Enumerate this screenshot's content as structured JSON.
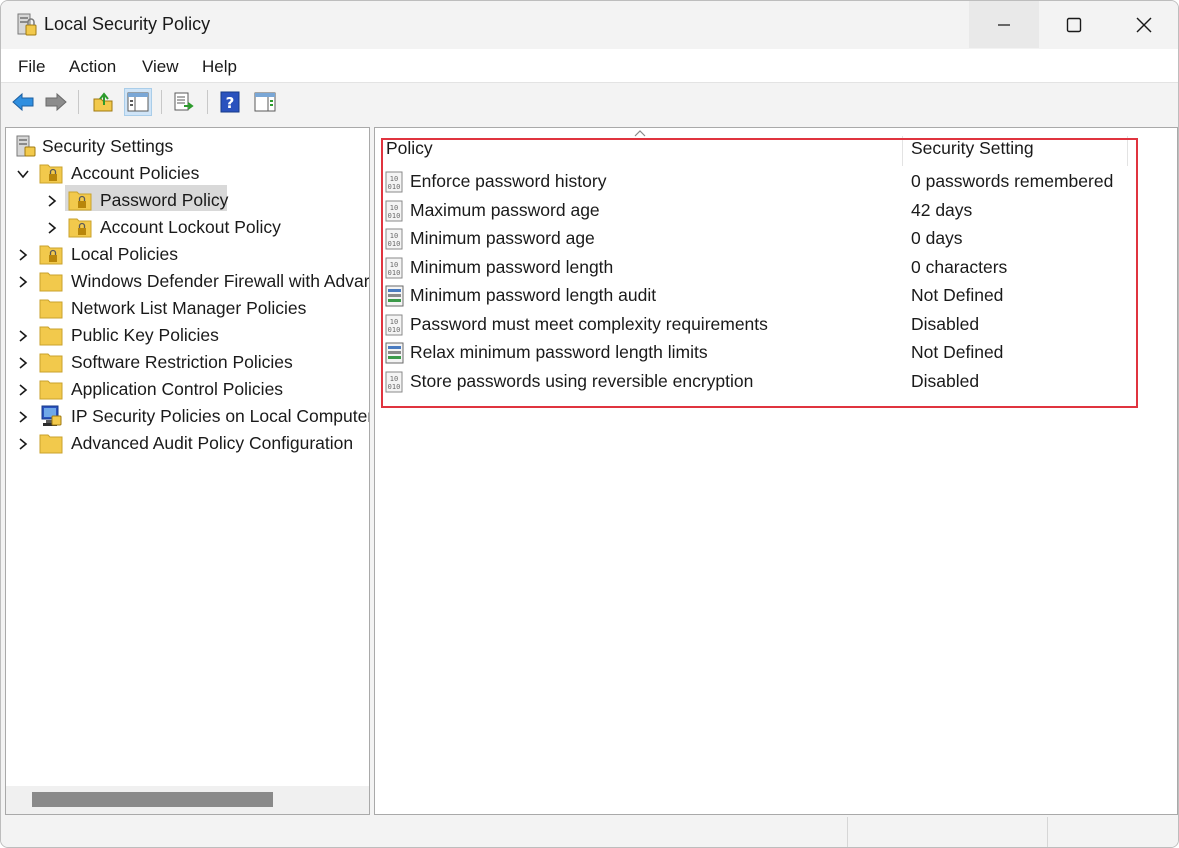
{
  "window": {
    "title": "Local Security Policy",
    "icon": "security-policy-icon"
  },
  "menu": [
    "File",
    "Action",
    "View",
    "Help"
  ],
  "toolbar": {
    "buttons": [
      "back-arrow-icon",
      "forward-arrow-icon",
      "up-folder-icon",
      "show-hide-tree-icon",
      "export-list-icon",
      "help-icon",
      "action-pane-icon"
    ]
  },
  "tree": {
    "root": "Security Settings",
    "items": [
      {
        "label": "Account Policies",
        "state": "expanded"
      },
      {
        "label": "Password Policy",
        "state": "selected"
      },
      {
        "label": "Account Lockout Policy",
        "state": "collapsed"
      },
      {
        "label": "Local Policies",
        "state": "collapsed"
      },
      {
        "label": "Windows Defender Firewall with Advar",
        "state": "collapsed"
      },
      {
        "label": "Network List Manager Policies",
        "state": "leaf"
      },
      {
        "label": "Public Key Policies",
        "state": "collapsed"
      },
      {
        "label": "Software Restriction Policies",
        "state": "collapsed"
      },
      {
        "label": "Application Control Policies",
        "state": "collapsed"
      },
      {
        "label": "IP Security Policies on Local Computer",
        "state": "collapsed"
      },
      {
        "label": "Advanced Audit Policy Configuration",
        "state": "collapsed"
      }
    ]
  },
  "list": {
    "columns": [
      "Policy",
      "Security Setting"
    ],
    "rows": [
      {
        "policy": "Enforce password history",
        "setting": "0 passwords remembered",
        "icon": "binary-policy-icon"
      },
      {
        "policy": "Maximum password age",
        "setting": "42 days",
        "icon": "binary-policy-icon"
      },
      {
        "policy": "Minimum password age",
        "setting": "0 days",
        "icon": "binary-policy-icon"
      },
      {
        "policy": "Minimum password length",
        "setting": "0 characters",
        "icon": "binary-policy-icon"
      },
      {
        "policy": "Minimum password length audit",
        "setting": "Not Defined",
        "icon": "list-policy-icon"
      },
      {
        "policy": "Password must meet complexity requirements",
        "setting": "Disabled",
        "icon": "binary-policy-icon"
      },
      {
        "policy": "Relax minimum password length limits",
        "setting": "Not Defined",
        "icon": "list-policy-icon"
      },
      {
        "policy": "Store passwords using reversible encryption",
        "setting": "Disabled",
        "icon": "binary-policy-icon"
      }
    ]
  },
  "colors": {
    "highlight": "#e0343f",
    "selection": "#d9d9d9",
    "folder": "#f2c94c"
  }
}
